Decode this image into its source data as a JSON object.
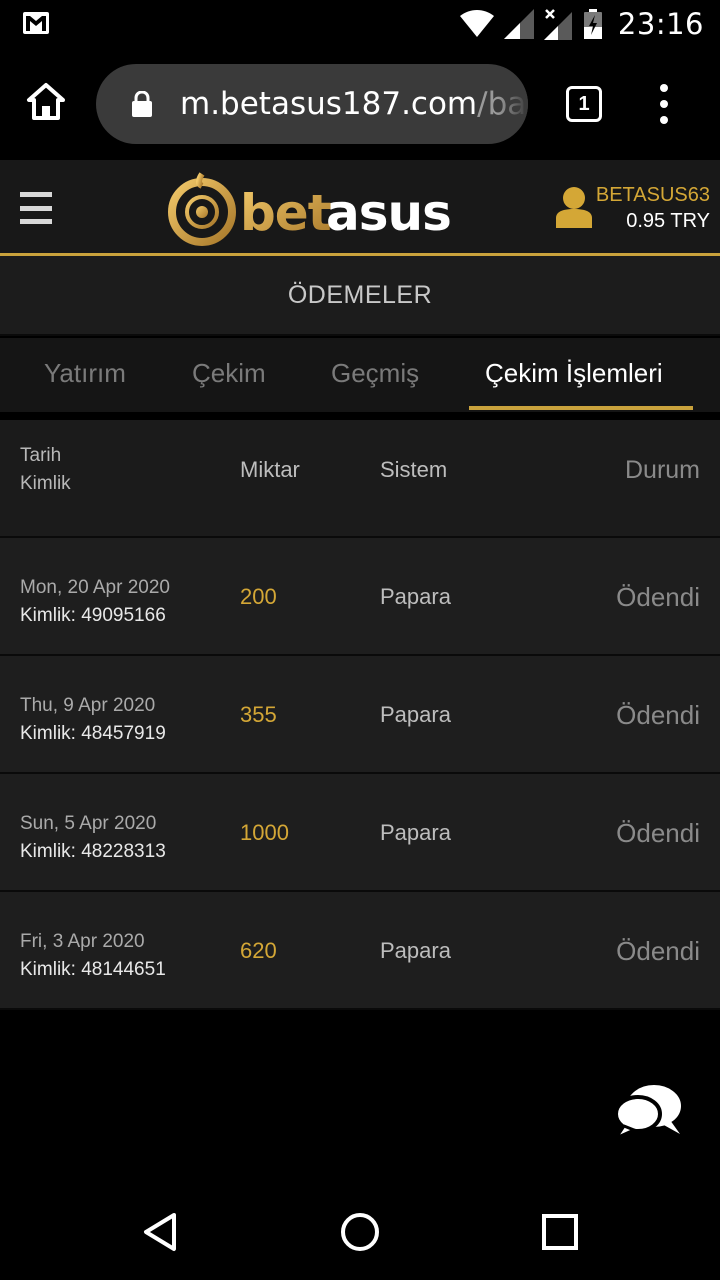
{
  "status_bar": {
    "time": "23:16",
    "icons": [
      "gmail-icon",
      "wifi-icon",
      "signal-icon",
      "signal-x-icon",
      "battery-charging-icon"
    ]
  },
  "browser": {
    "url_host": "m.betasus187.com",
    "url_path": "/bal",
    "tab_count": "1"
  },
  "header": {
    "logo_text": "betasus",
    "username": "BETASUS63",
    "balance": "0.95 TRY",
    "accent_color": "#c9a23c"
  },
  "section_title": "ÖDEMELER",
  "tabs": [
    {
      "label": "Yatırım",
      "active": false
    },
    {
      "label": "Çekim",
      "active": false
    },
    {
      "label": "Geçmiş",
      "active": false
    },
    {
      "label": "Çekim İşlemleri",
      "active": true
    }
  ],
  "table": {
    "headers": {
      "date": "Tarih",
      "id": "Kimlik",
      "amount": "Miktar",
      "system": "Sistem",
      "status": "Durum"
    },
    "rows": [
      {
        "date": "Mon, 20 Apr 2020",
        "id": "Kimlik: 49095166",
        "amount": "200",
        "system": "Papara",
        "status": "Ödendi"
      },
      {
        "date": "Thu, 9 Apr 2020",
        "id": "Kimlik: 48457919",
        "amount": "355",
        "system": "Papara",
        "status": "Ödendi"
      },
      {
        "date": "Sun, 5 Apr 2020",
        "id": "Kimlik: 48228313",
        "amount": "1000",
        "system": "Papara",
        "status": "Ödendi"
      },
      {
        "date": "Fri, 3 Apr 2020",
        "id": "Kimlik: 48144651",
        "amount": "620",
        "system": "Papara",
        "status": "Ödendi"
      }
    ]
  }
}
